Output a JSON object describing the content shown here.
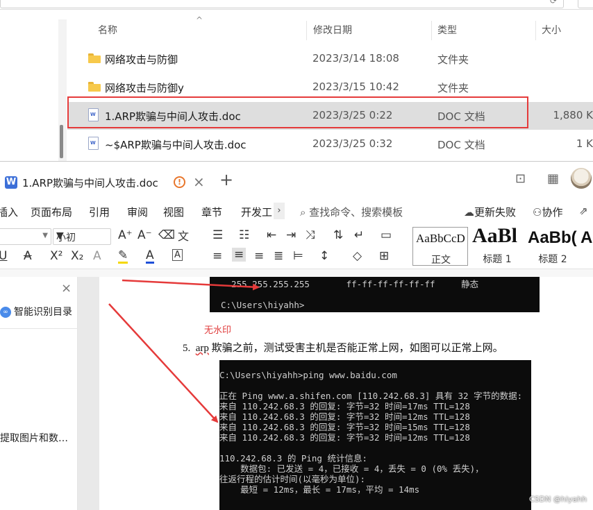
{
  "explorer": {
    "columns": {
      "name": "名称",
      "modified": "修改日期",
      "type": "类型",
      "size": "大小"
    },
    "rows": [
      {
        "name": "网络攻击与防御",
        "modified": "2023/3/14 18:08",
        "type": "文件夹",
        "size": "",
        "icon": "folder-icon"
      },
      {
        "name": "网络攻击与防御y",
        "modified": "2023/3/15 10:42",
        "type": "文件夹",
        "size": "",
        "icon": "folder-icon"
      },
      {
        "name": "1.ARP欺骗与中间人攻击.doc",
        "modified": "2023/3/25 0:22",
        "type": "DOC 文档",
        "size": "1,880 K",
        "icon": "doc-icon"
      },
      {
        "name": "~$ARP欺骗与中间人攻击.doc",
        "modified": "2023/3/25 0:32",
        "type": "DOC 文档",
        "size": "1 K",
        "icon": "doc-icon"
      }
    ],
    "highlight_color": "#e53a3a",
    "selected_bg": "#dedede"
  },
  "wps": {
    "tab_title": "1.ARP欺骗与中间人攻击.doc",
    "logo_letter": "W",
    "warn_glyph": "!",
    "menus": [
      "插入",
      "页面布局",
      "引用",
      "审阅",
      "视图",
      "章节",
      "开发工"
    ],
    "menu_more": "›",
    "command_search": "查找命令、搜索模板",
    "update_failed": "更新失败",
    "collaborate": "协作",
    "font_size": "小初",
    "styles": [
      {
        "sample": "AaBbCcD",
        "label": "正文"
      },
      {
        "sample": "AaBl",
        "label": "标题 1"
      },
      {
        "sample": "AaBb(",
        "label": "标题 2"
      },
      {
        "sample": "A",
        "label": ""
      }
    ],
    "sidepane": {
      "smart_toc": "智能识别目录",
      "smart_toc_glyph": "∞",
      "extract_item": "提取图片和数…"
    }
  },
  "document": {
    "console1_lines": [
      "  255.255.255.255       ff-ff-ff-ff-ff-ff     静态",
      "",
      "C:\\Users\\hiyahh>"
    ],
    "watermark_label": "无水印",
    "step5_number": "5.",
    "step5_arp": "arp",
    "step5_text": " 欺骗之前，测试受害主机是否能正常上网，如图可以正常上网。",
    "console2_lines": [
      "C:\\Users\\hiyahh>ping www.baidu.com",
      "",
      "正在 Ping www.a.shifen.com [110.242.68.3] 具有 32 字节的数据:",
      "来自 110.242.68.3 的回复: 字节=32 时间=17ms TTL=128",
      "来自 110.242.68.3 的回复: 字节=32 时间=12ms TTL=128",
      "来自 110.242.68.3 的回复: 字节=32 时间=15ms TTL=128",
      "来自 110.242.68.3 的回复: 字节=32 时间=12ms TTL=128",
      "",
      "110.242.68.3 的 Ping 统计信息:",
      "    数据包: 已发送 = 4，已接收 = 4，丢失 = 0 (0% 丢失)，",
      "往返行程的估计时间(以毫秒为单位):",
      "    最短 = 12ms，最长 = 17ms，平均 = 14ms"
    ],
    "csdn_watermark": "CSDN @hiyahh",
    "arrow_color": "#e53a3a"
  }
}
